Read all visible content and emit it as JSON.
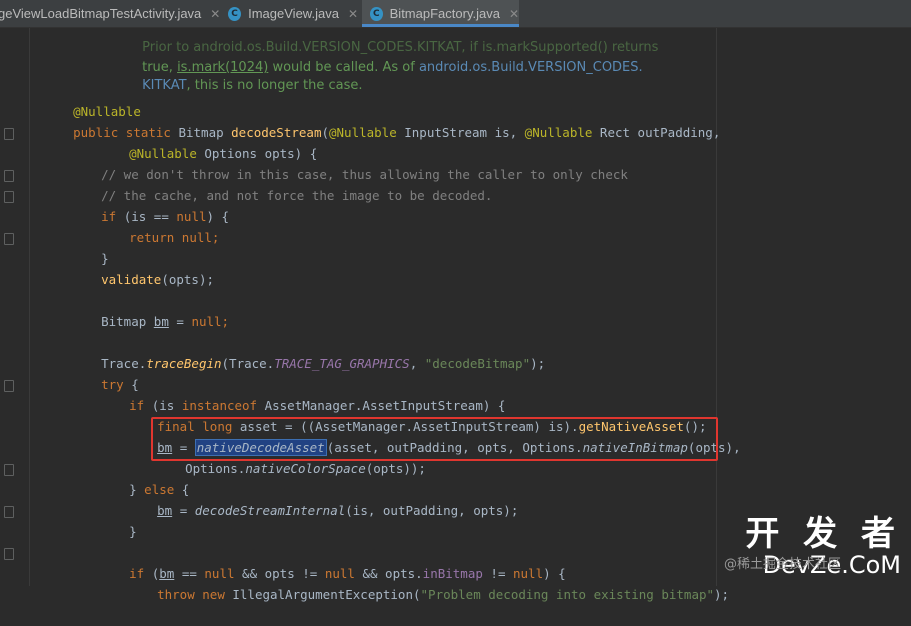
{
  "tabs": [
    {
      "label": "geViewLoadBitmapTestActivity.java",
      "icon": "java-class-icon",
      "active": false
    },
    {
      "label": "ImageView.java",
      "icon": "java-class-icon",
      "active": false
    },
    {
      "label": "BitmapFactory.java",
      "icon": "java-class-icon",
      "active": true
    }
  ],
  "code": {
    "l1": "Prior to android.os.Build.VERSION_CODES.KITKAT, if is.markSupported() returns",
    "l2a": "true, ",
    "l2b": "is.mark(1024)",
    "l2c": " would be called. As of ",
    "l2d": "android.os.Build.VERSION_CODES.",
    "l3a": "KITKAT",
    "l3b": ", this is no longer the case.",
    "ann": "@Nullable",
    "sig1a": "public static ",
    "sig1b": "Bitmap ",
    "sig1c": "decodeStream",
    "sig1d": "(",
    "sig1e": "@Nullable",
    "sig1f": " InputStream is, ",
    "sig1g": "@Nullable",
    "sig1h": " Rect outPadding,",
    "sig2a": "@Nullable",
    "sig2b": " Options opts) {",
    "c1": "// we don't throw in this case, thus allowing the caller to only check",
    "c2": "// the cache, and not force the image to be decoded.",
    "if1a": "if",
    "if1b": " (is == ",
    "if1c": "null",
    "if1d": ") {",
    "ret1a": "return ",
    "ret1b": "null",
    "ret1c": ";",
    "close1": "}",
    "val1": "validate",
    "val2": "(opts);",
    "bm1a": "Bitmap ",
    "bm1b": "bm",
    "bm1c": " = ",
    "bm1d": "null",
    "bm1e": ";",
    "tr1": "Trace.",
    "tr2": "traceBegin",
    "tr3": "(Trace.",
    "tr4": "TRACE_TAG_GRAPHICS",
    "tr5": ", ",
    "tr6": "\"decodeBitmap\"",
    "tr7": ");",
    "try1": "try",
    "try2": " {",
    "if2a": "if",
    "if2b": " (is ",
    "if2c": "instanceof",
    "if2d": " AssetManager.AssetInputStream) {",
    "fin1": "final long",
    "fin2": " asset = ((AssetManager.AssetInputStream) is).",
    "fin3": "getNativeAsset",
    "fin4": "();",
    "nd1": "bm",
    "nd2": " = ",
    "nd3": "nativeDecodeAsset",
    "nd4": "(asset, outPadding, opts, Options.",
    "nd5": "nativeInBitmap",
    "nd6": "(opts),",
    "nc1": "Options.",
    "nc2": "nativeColorSpace",
    "nc3": "(opts));",
    "else1": "} ",
    "else2": "else",
    "else3": " {",
    "ds1": "bm",
    "ds2": " = ",
    "ds3": "decodeStreamInternal",
    "ds4": "(is, outPadding, opts);",
    "close2": "}",
    "if3a": "if",
    "if3b": " (",
    "if3c": "bm",
    "if3d": " == ",
    "if3e": "null",
    "if3f": " && opts != ",
    "if3g": "null",
    "if3h": " && opts.",
    "if3i": "inBitmap",
    "if3j": " != ",
    "if3k": "null",
    "if3l": ") {",
    "th1": "throw new",
    "th2": " IllegalArgumentException(",
    "th3": "\"Problem decoding into existing bitmap\"",
    "th4": ");"
  },
  "watermark": {
    "title": "开 发 者",
    "subtitle": "DevZe.CoM",
    "attribution": "@稀土掘金技术社区"
  },
  "colors": {
    "background": "#2b2b2b",
    "keyword": "#cc7832",
    "annotation": "#bbb529",
    "method": "#ffc66d",
    "comment": "#808080",
    "string": "#6a8759",
    "highlight_box": "#e0362f"
  }
}
